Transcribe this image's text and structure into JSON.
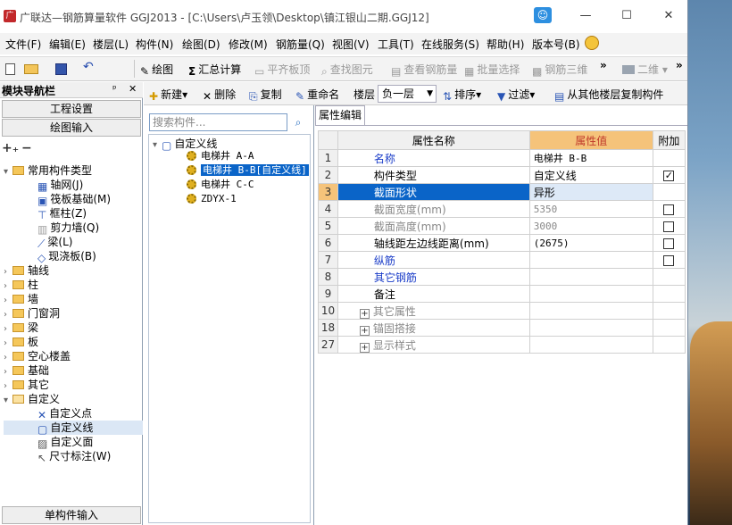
{
  "window": {
    "title": "广联达—钢筋算量软件 GGJ2013 - [C:\\Users\\卢玉领\\Desktop\\镇江银山二期.GGJ12]",
    "controls": {
      "minimize": "—",
      "maximize": "☐",
      "close": "✕"
    }
  },
  "menu": [
    "文件(F)",
    "编辑(E)",
    "楼层(L)",
    "构件(N)",
    "绘图(D)",
    "修改(M)",
    "钢筋量(Q)",
    "视图(V)",
    "工具(T)",
    "在线服务(S)",
    "帮助(H)",
    "版本号(B)"
  ],
  "toolbar": {
    "draw": "绘图",
    "sum": "汇总计算",
    "flatten_slab": "平齐板顶",
    "find_element": "查找图元",
    "view_rebar": "查看钢筋量",
    "batch_select": "批量选择",
    "rebar_3d": "钢筋三维",
    "view_mode": "二维"
  },
  "nav": {
    "title": "模块导航栏",
    "pin": "ᵖ",
    "close": "✕",
    "project_settings": "工程设置",
    "drawing_input": "绘图输入",
    "single_input": "单构件输入",
    "tree": {
      "common": "常用构件类型",
      "common_items": [
        "轴网(J)",
        "筏板基础(M)",
        "框柱(Z)",
        "剪力墙(Q)",
        "梁(L)",
        "现浇板(B)"
      ],
      "groups": [
        "轴线",
        "柱",
        "墙",
        "门窗洞",
        "梁",
        "板",
        "空心楼盖",
        "基础",
        "其它"
      ],
      "custom": "自定义",
      "custom_items": [
        "自定义点",
        "自定义线",
        "自定义面",
        "尺寸标注(W)"
      ]
    }
  },
  "component_toolbar": {
    "new": "新建",
    "delete": "删除",
    "copy": "复制",
    "rename": "重命名",
    "floor_label": "楼层",
    "floor_value": "负一层",
    "sort": "排序",
    "filter": "过滤",
    "copy_from_floor": "从其他楼层复制构件"
  },
  "search": {
    "placeholder": "搜索构件..."
  },
  "component_tree": {
    "root": "自定义线",
    "items": [
      "电梯井 A-A",
      "电梯井 B-B[自定义线]",
      "电梯井 C-C",
      "ZDYX-1"
    ]
  },
  "props": {
    "tab": "属性编辑",
    "headers": [
      "属性名称",
      "属性值",
      "附加"
    ],
    "rows": [
      {
        "n": "1",
        "name": "名称",
        "value": "电梯井 B-B",
        "check": false
      },
      {
        "n": "2",
        "name": "构件类型",
        "value": "自定义线",
        "check": true
      },
      {
        "n": "3",
        "name": "截面形状",
        "value": "异形",
        "check": false
      },
      {
        "n": "4",
        "name": "截面宽度(mm)",
        "value": "5350",
        "check": false
      },
      {
        "n": "5",
        "name": "截面高度(mm)",
        "value": "3000",
        "check": false
      },
      {
        "n": "6",
        "name": "轴线距左边线距离(mm)",
        "value": "(2675)",
        "check": false
      },
      {
        "n": "7",
        "name": "纵筋",
        "value": "",
        "check": false
      },
      {
        "n": "8",
        "name": "其它钢筋",
        "value": "",
        "check": false
      },
      {
        "n": "9",
        "name": "备注",
        "value": "",
        "check": false
      },
      {
        "n": "10",
        "name": "其它属性",
        "value": "",
        "check": false
      },
      {
        "n": "18",
        "name": "锚固搭接",
        "value": "",
        "check": false
      },
      {
        "n": "27",
        "name": "显示样式",
        "value": "",
        "check": false
      }
    ]
  },
  "colors": {
    "selection": "#0a64c8",
    "header_value_bg": "#f5c37a",
    "link": "#1a3cc8"
  }
}
